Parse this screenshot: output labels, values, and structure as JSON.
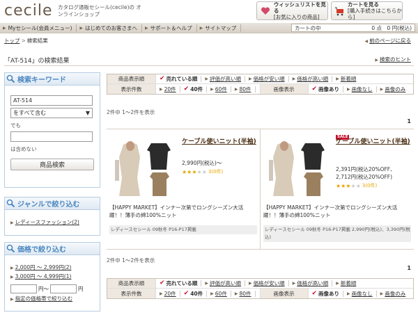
{
  "header": {
    "logo": "cecile",
    "tagline": "カタログ通販セシール(cecile)の オンラインショップ",
    "wishlist_title": "ウィッシュリストを見る",
    "wishlist_sub": "[お気に入りの商品]",
    "cart_title": "カートを見る",
    "cart_sub": "[購入手続きはこちらから]"
  },
  "nav": {
    "items": [
      "Myセシール(会員メニュー)",
      "はじめてのお客さまへ",
      "サポート＆ヘルプ",
      "サイトマップ"
    ],
    "cart_label": "カートの中",
    "cart_value": "0 点　0 円(税込)"
  },
  "breadcrumb": {
    "home": "トップ",
    "sep": ">",
    "current": "検索結果",
    "back": "前のページに戻る"
  },
  "page": {
    "title": "「AT-514」の検索結果",
    "hint": "検索のヒント"
  },
  "sidebar": {
    "keyword_head": "検索キーワード",
    "keyword_value": "AT-514",
    "match_value": "をすべて含む",
    "but_label": "でも",
    "exclude_value": "",
    "exclude_label": "は含めない",
    "search_button": "商品検索",
    "genre_head": "ジャンルで絞り込む",
    "genre_items": [
      "レディースファッション(2)"
    ],
    "price_head": "価格で絞り込む",
    "price_items": [
      "2,000円 ～ 2,999円(2)",
      "3,000円 ～ 4,999円(1)"
    ],
    "price_from": "",
    "price_sep": "円～",
    "price_to": "",
    "price_unit": "円",
    "price_submit": "指定の価格帯で絞り込む"
  },
  "sort": {
    "order_label": "商品表示順",
    "orders": [
      "売れている順",
      "評価が高い順",
      "価格が安い順",
      "価格が高い順",
      "新着順"
    ],
    "count_label": "表示件数",
    "counts": [
      "20件",
      "40件",
      "60件",
      "80件"
    ],
    "image_label": "画像表示",
    "images": [
      "画像あり",
      "画像なし",
      "画像のみ"
    ]
  },
  "results": {
    "count_text": "2件中 1～2件を表示",
    "page": "1"
  },
  "products": [
    {
      "name": "ケーブル使いニット(半袖)",
      "price": "2,990円(税込)～",
      "price2": "",
      "sale": "",
      "rating": 3,
      "review_count": "3(0件)",
      "desc": "【HAPPY MARKET】インナー次第でロングシーズン大活躍！！薄手の綿100%ニット",
      "catalog": "レディースセシール 09秋冬 P16-P17掲載"
    },
    {
      "name": "ケーブル使いニット(半袖)",
      "price": "2,391円(税込20%OFF、",
      "price2": "2,712円(税込20%OFF)",
      "sale": "SALE",
      "rating": 3,
      "review_count": "3(0件)",
      "desc": "【HAPPY MARKET】インナー次第でロングシーズン大活躍！！薄手の綿100%ニット",
      "catalog": "レディースセシール 09秋冬 P16-P17掲載 2,990円(税込)、3,390円(税込)"
    }
  ]
}
